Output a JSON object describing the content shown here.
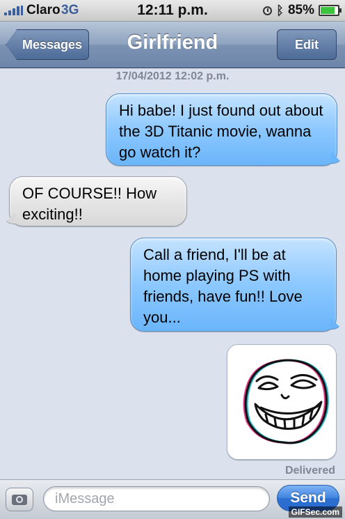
{
  "status_bar": {
    "carrier": "Claro",
    "network": "3G",
    "time": "12:11 p.m.",
    "battery": "85%",
    "battery_level": 0.85
  },
  "nav": {
    "back_label": "Messages",
    "title": "Girlfriend",
    "edit_label": "Edit"
  },
  "timestamp": "17/04/2012 12:02 p.m.",
  "messages": [
    {
      "side": "sent",
      "text": "Hi babe! I just found out about the 3D Titanic movie, wanna go watch it?"
    },
    {
      "side": "received",
      "text": "OF COURSE!! How exciting!!"
    },
    {
      "side": "sent",
      "text": "Call a friend, I'll be at home playing PS with friends, have fun!! Love you..."
    },
    {
      "side": "sent",
      "type": "image",
      "image": "trollface"
    }
  ],
  "delivered_label": "Delivered",
  "input": {
    "placeholder": "iMessage",
    "value": ""
  },
  "send_label": "Send",
  "watermark": "GIFSec.com",
  "colors": {
    "sent_bubble": "#8cc8ff",
    "received_bubble": "#e3e3e3",
    "nav_bar": "#7b92b3",
    "background": "#dbe2ed"
  }
}
